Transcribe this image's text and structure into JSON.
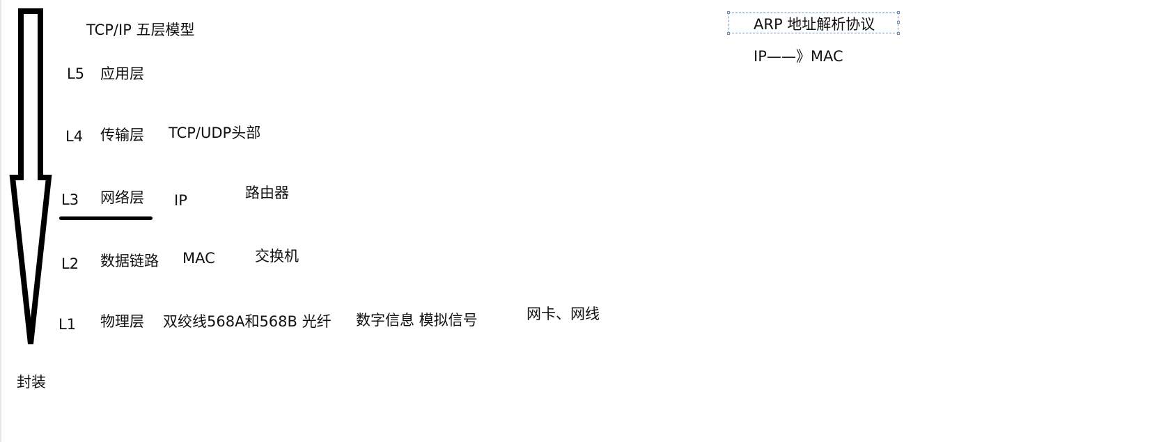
{
  "title": "TCP/IP 五层模型",
  "layers": [
    {
      "id": "L5",
      "name": "应用层",
      "extras": []
    },
    {
      "id": "L4",
      "name": "传输层",
      "extras": [
        "TCP/UDP头部"
      ]
    },
    {
      "id": "L3",
      "name": "网络层",
      "extras": [
        "IP",
        "路由器"
      ]
    },
    {
      "id": "L2",
      "name": "数据链路",
      "extras": [
        "MAC",
        "交换机"
      ]
    },
    {
      "id": "L1",
      "name": "物理层",
      "extras": [
        "双绞线568A和568B 光纤",
        "数字信息 模拟信号",
        "网卡、网线"
      ]
    }
  ],
  "encapsulation_label": "封装",
  "arp": {
    "title": "ARP 地址解析协议",
    "mapping": "IP——》MAC"
  }
}
